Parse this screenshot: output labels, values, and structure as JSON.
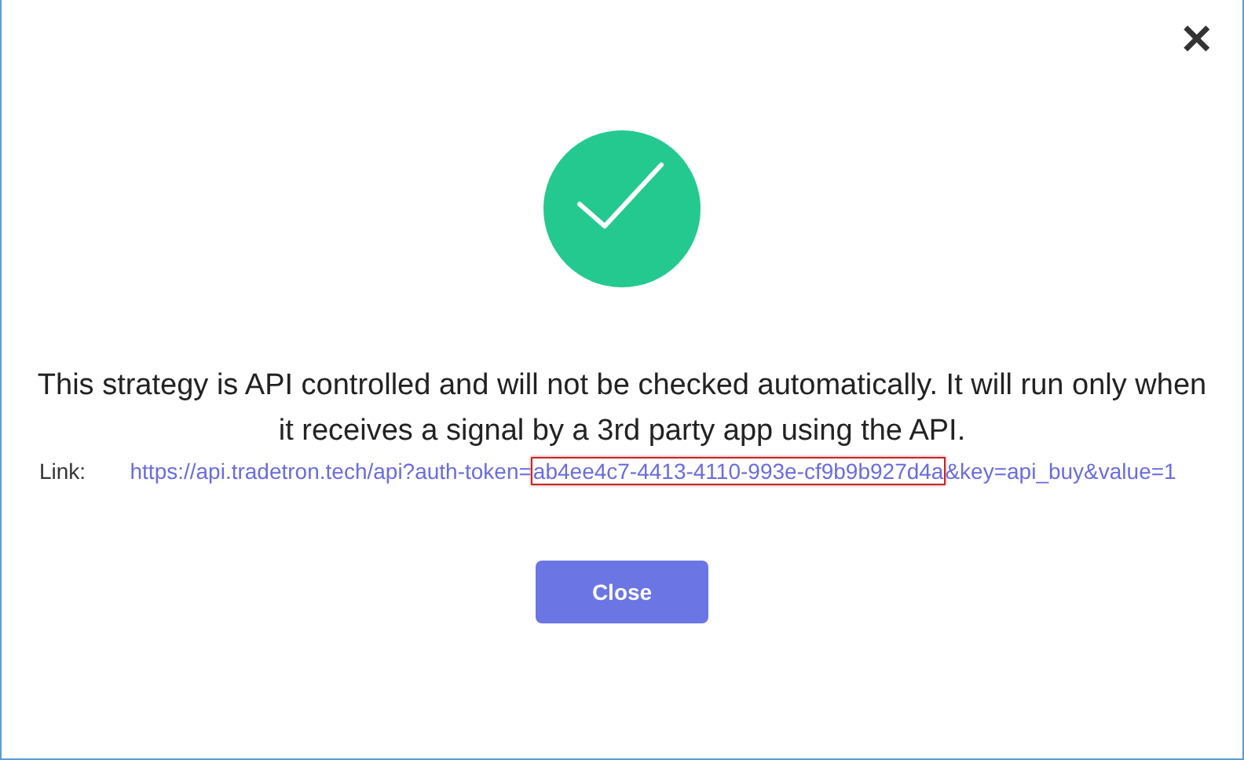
{
  "dialog": {
    "close_icon": "✕",
    "message": "This strategy is API controlled and will not be checked automatically. It will run only when it receives a signal by a 3rd party app using the API.",
    "link_label": "Link:",
    "link": [
      {
        "text": "https://api.tradetron.tech/api?auth-token=",
        "highlighted": false
      },
      {
        "text": "ab4ee4c7-4413-4110-993e-cf9b9b927d4a",
        "highlighted": true
      },
      {
        "text": "&key=api_buy&value=1",
        "highlighted": false
      }
    ],
    "button": "Close"
  }
}
